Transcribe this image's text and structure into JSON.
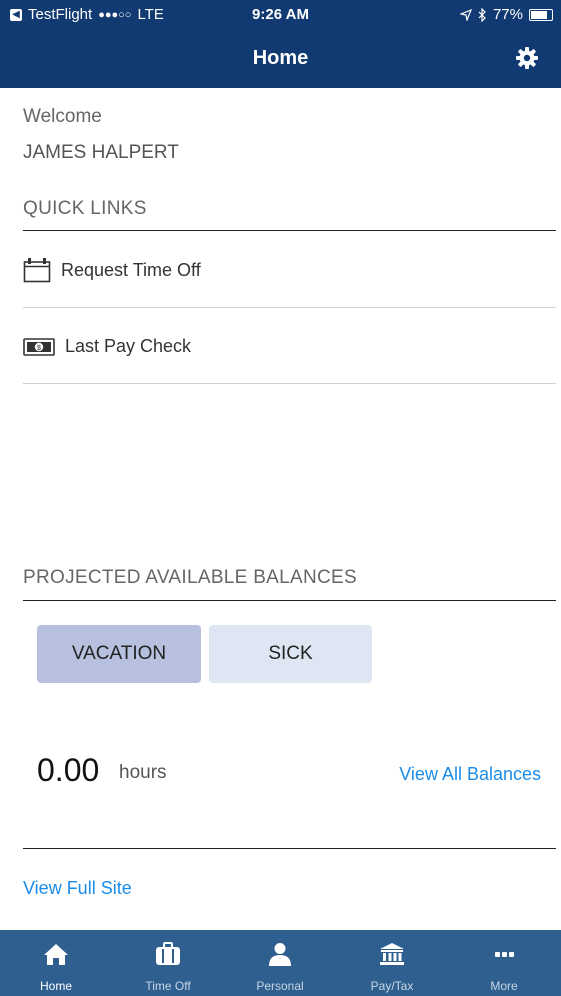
{
  "status_bar": {
    "carrier": "TestFlight",
    "signal": "●●●○○",
    "network": "LTE",
    "time": "9:26 AM",
    "battery": "77%"
  },
  "nav": {
    "title": "Home",
    "settings_icon": "gear-icon"
  },
  "welcome": {
    "greeting": "Welcome",
    "name": "JAMES HALPERT"
  },
  "quick_links": {
    "title": "QUICK LINKS",
    "items": [
      {
        "label": "Request Time Off",
        "icon": "calendar-icon"
      },
      {
        "label": "Last Pay Check",
        "icon": "money-icon"
      }
    ]
  },
  "balances": {
    "title": "PROJECTED AVAILABLE BALANCES",
    "tabs": [
      {
        "label": "VACATION",
        "selected": true
      },
      {
        "label": "SICK",
        "selected": false
      }
    ],
    "value": "0.00",
    "unit": "hours",
    "view_all_label": "View All Balances"
  },
  "view_full_site_label": "View Full Site",
  "tab_bar": [
    {
      "label": "Home",
      "icon": "home-icon",
      "active": true
    },
    {
      "label": "Time Off",
      "icon": "briefcase-icon",
      "active": false
    },
    {
      "label": "Personal",
      "icon": "person-icon",
      "active": false
    },
    {
      "label": "Pay/Tax",
      "icon": "bank-icon",
      "active": false
    },
    {
      "label": "More",
      "icon": "more-icon",
      "active": false
    }
  ],
  "colors": {
    "header_bg": "#123a72",
    "tabbar_bg": "#2e5f8f",
    "link": "#1b8ce8",
    "selected_tab": "#b7c1df",
    "unselected_tab": "#dde6f2"
  }
}
